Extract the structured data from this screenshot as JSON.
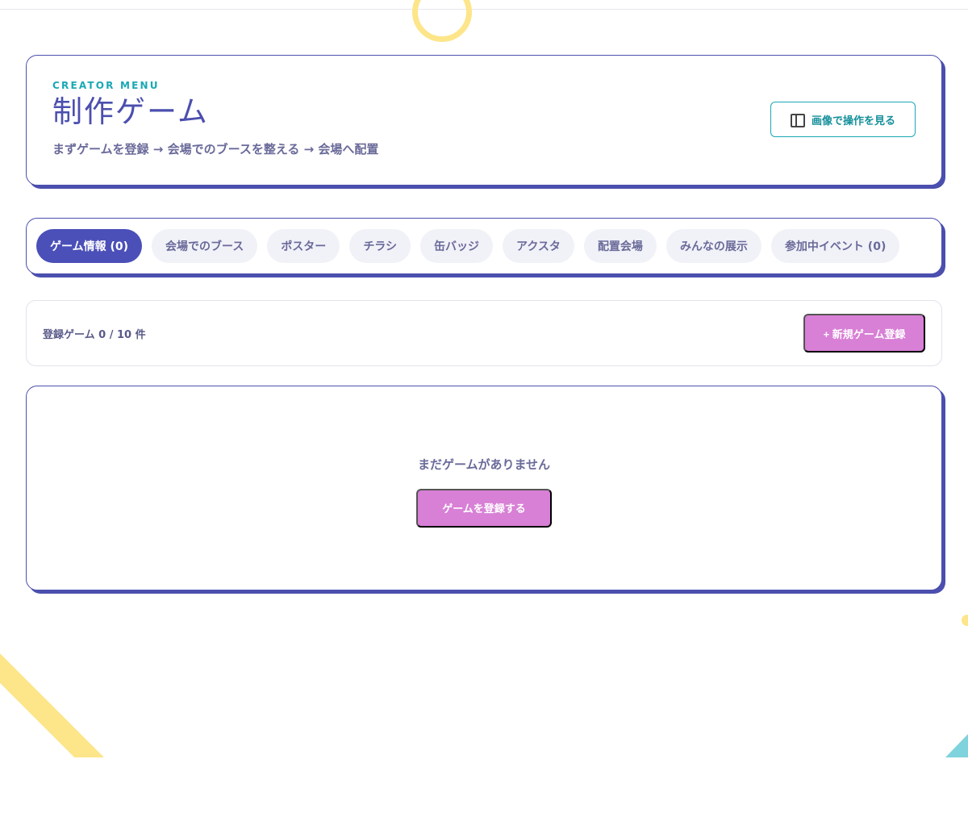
{
  "header": {
    "eyebrow": "CREATOR MENU",
    "title": "制作ゲーム",
    "subtitle": "まずゲームを登録 → 会場でのブースを整える → 会場へ配置",
    "howto_button": "画像で操作を見る"
  },
  "tabs": [
    {
      "label": "ゲーム情報 (0)",
      "active": true
    },
    {
      "label": "会場でのブース",
      "active": false
    },
    {
      "label": "ポスター",
      "active": false
    },
    {
      "label": "チラシ",
      "active": false
    },
    {
      "label": "缶バッジ",
      "active": false
    },
    {
      "label": "アクスタ",
      "active": false
    },
    {
      "label": "配置会場",
      "active": false
    },
    {
      "label": "みんなの展示",
      "active": false
    },
    {
      "label": "参加中イベント (0)",
      "active": false
    }
  ],
  "toolbar": {
    "count_label": "登録ゲーム 0 / 10 件",
    "new_button": "+ 新規ゲーム登録"
  },
  "empty_state": {
    "message": "まだゲームがありません",
    "register_button": "ゲームを登録する"
  },
  "colors": {
    "primary": "#4b4fae",
    "accent_teal": "#19a8b4",
    "pink_button": "#d87fd6",
    "deco_yellow": "#fde58a",
    "deco_teal": "#7fd3dc"
  },
  "icons": {
    "howto": "book-icon"
  }
}
